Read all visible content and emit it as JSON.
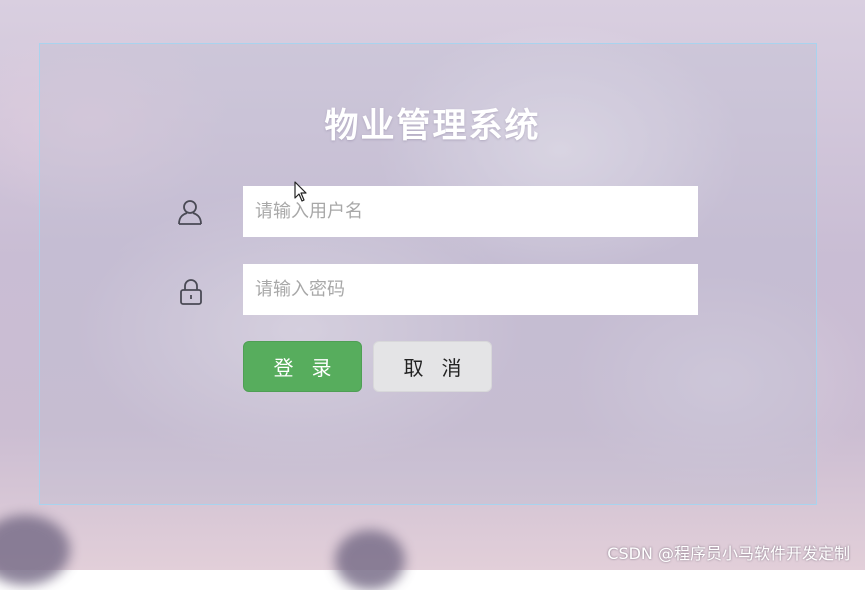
{
  "app": {
    "title": "物业管理系统"
  },
  "form": {
    "username": {
      "icon": "user-icon",
      "placeholder": "请输入用户名",
      "value": ""
    },
    "password": {
      "icon": "lock-icon",
      "placeholder": "请输入密码",
      "value": ""
    },
    "login_label": "登录",
    "cancel_label": "取消"
  },
  "watermark": "CSDN @程序员小马软件开发定制",
  "colors": {
    "login_button": "#57ad5d",
    "cancel_button": "#e4e4e6",
    "panel_border": "#a9d3ee",
    "title": "#ffffff"
  }
}
